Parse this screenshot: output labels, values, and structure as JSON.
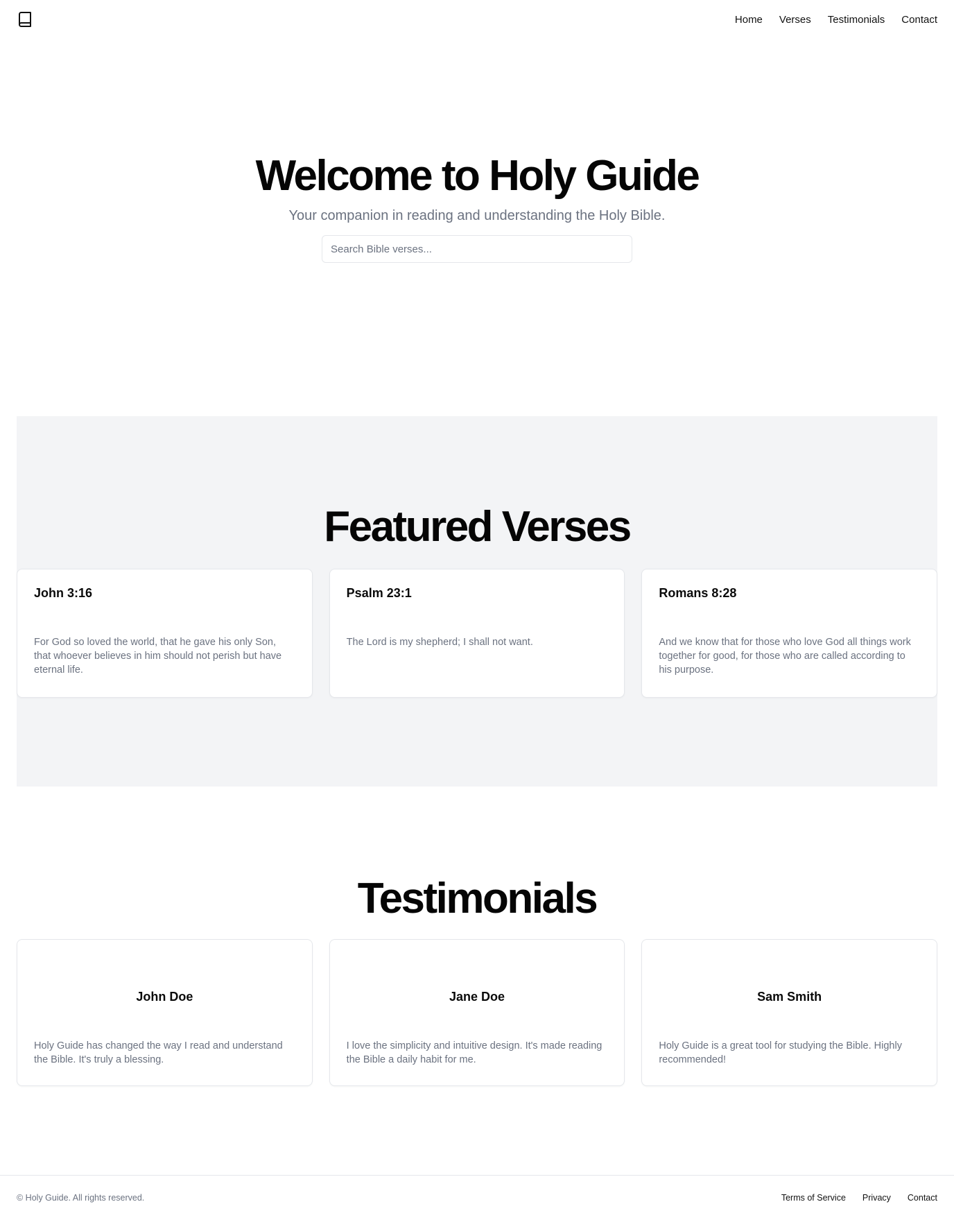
{
  "header": {
    "logo_icon": "book-icon",
    "nav": [
      {
        "label": "Home"
      },
      {
        "label": "Verses"
      },
      {
        "label": "Testimonials"
      },
      {
        "label": "Contact"
      }
    ]
  },
  "hero": {
    "title": "Welcome to Holy Guide",
    "subtitle": "Your companion in reading and understanding the Holy Bible.",
    "search_placeholder": "Search Bible verses...",
    "search_value": ""
  },
  "featured": {
    "title": "Featured Verses",
    "verses": [
      {
        "reference": "John 3:16",
        "text": "For God so loved the world, that he gave his only Son, that whoever believes in him should not perish but have eternal life."
      },
      {
        "reference": "Psalm 23:1",
        "text": "The Lord is my shepherd; I shall not want."
      },
      {
        "reference": "Romans 8:28",
        "text": "And we know that for those who love God all things work together for good, for those who are called according to his purpose."
      }
    ]
  },
  "testimonials": {
    "title": "Testimonials",
    "items": [
      {
        "name": "John Doe",
        "text": "Holy Guide has changed the way I read and understand the Bible. It's truly a blessing."
      },
      {
        "name": "Jane Doe",
        "text": "I love the simplicity and intuitive design. It's made reading the Bible a daily habit for me."
      },
      {
        "name": "Sam Smith",
        "text": "Holy Guide is a great tool for studying the Bible. Highly recommended!"
      }
    ]
  },
  "footer": {
    "copyright": "© Holy Guide. All rights reserved.",
    "links": [
      {
        "label": "Terms of Service"
      },
      {
        "label": "Privacy"
      },
      {
        "label": "Contact"
      }
    ]
  }
}
